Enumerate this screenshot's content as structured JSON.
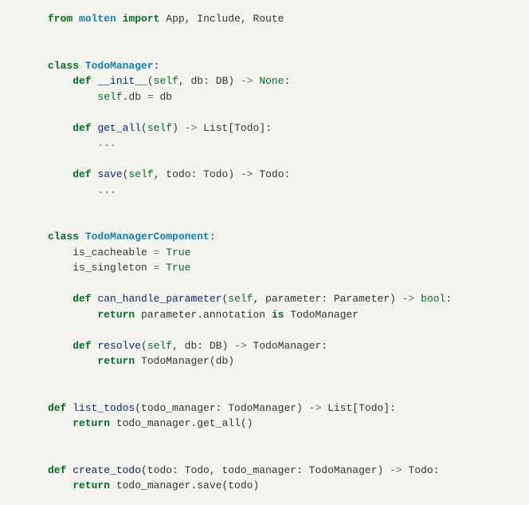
{
  "code": {
    "l1": {
      "from": "from",
      "mod": "molten",
      "import": "import",
      "names": "App, Include, Route"
    },
    "l2": {
      "cls": "class",
      "name": "TodoManager",
      "colon": ":"
    },
    "l3": {
      "def": "def",
      "fn": "__init__",
      "args_open": "(",
      "self": "self",
      "args_rest": ", db: DB)",
      "arrow": " -> ",
      "ret": "None",
      "colon": ":"
    },
    "l4": {
      "self": "self",
      "rest": ".db ",
      "eq": "=",
      "rhs": " db"
    },
    "l5": {
      "def": "def",
      "fn": "get_all",
      "args_open": "(",
      "self": "self",
      "args_close": ")",
      "arrow": " -> ",
      "ret": "List[Todo]",
      "colon": ":"
    },
    "l6": {
      "dots": "..."
    },
    "l7": {
      "def": "def",
      "fn": "save",
      "args_open": "(",
      "self": "self",
      "args_rest": ", todo: Todo)",
      "arrow": " -> ",
      "ret": "Todo",
      "colon": ":"
    },
    "l8": {
      "dots": "..."
    },
    "l9": {
      "cls": "class",
      "name": "TodoManagerComponent",
      "colon": ":"
    },
    "l10": {
      "var": "is_cacheable ",
      "eq": "=",
      "val": " True"
    },
    "l11": {
      "var": "is_singleton ",
      "eq": "=",
      "val": " True"
    },
    "l12": {
      "def": "def",
      "fn": "can_handle_parameter",
      "args_open": "(",
      "self": "self",
      "args_rest": ", parameter: Parameter)",
      "arrow": " -> ",
      "ret": "bool",
      "colon": ":"
    },
    "l13": {
      "return": "return",
      "rest": " parameter.annotation ",
      "is": "is",
      "rhs": " TodoManager"
    },
    "l14": {
      "def": "def",
      "fn": "resolve",
      "args_open": "(",
      "self": "self",
      "args_rest": ", db: DB)",
      "arrow": " -> ",
      "ret": "TodoManager",
      "colon": ":"
    },
    "l15": {
      "return": "return",
      "rest": " TodoManager(db)"
    },
    "l16": {
      "def": "def",
      "fn": "list_todos",
      "args": "(todo_manager: TodoManager)",
      "arrow": " -> ",
      "ret": "List[Todo]",
      "colon": ":"
    },
    "l17": {
      "return": "return",
      "rest": " todo_manager.get_all()"
    },
    "l18": {
      "def": "def",
      "fn": "create_todo",
      "args": "(todo: Todo, todo_manager: TodoManager)",
      "arrow": " -> ",
      "ret": "Todo",
      "colon": ":"
    },
    "l19": {
      "return": "return",
      "rest": " todo_manager.save(todo)"
    }
  }
}
